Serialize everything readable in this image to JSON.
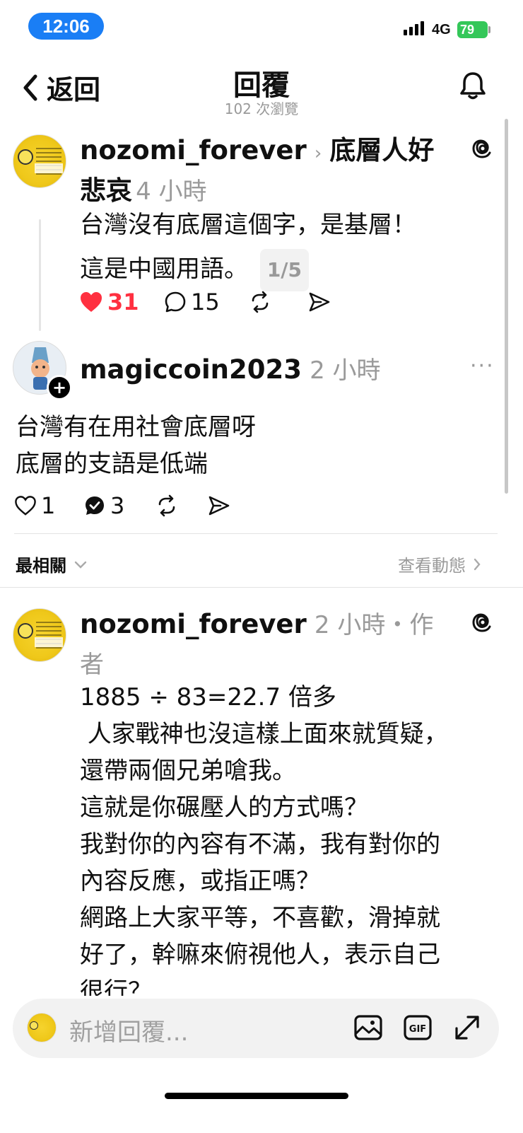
{
  "status_bar": {
    "time": "12:06",
    "network": "4G",
    "battery": "79"
  },
  "header": {
    "back_label": "返回",
    "title": "回覆",
    "views": "102 次瀏覽"
  },
  "post1": {
    "username": "nozomi_forever",
    "topic_line1": "底層人好",
    "topic_line2": "悲哀",
    "time": "4 小時",
    "text_line1": "台灣沒有底層這個字，是基層！",
    "text_line2": "這是中國用語。",
    "pager": "1/5",
    "likes": "31",
    "comments": "15"
  },
  "reply1": {
    "username": "magiccoin2023",
    "time": "2 小時",
    "text_line1": "台灣有在用社會底層呀",
    "text_line2": "底層的支語是低端",
    "likes": "1",
    "comments": "3"
  },
  "sort": {
    "label": "最相關",
    "activity": "查看動態"
  },
  "post2": {
    "username": "nozomi_forever",
    "time_line1": "2 小時・作",
    "time_line2": "者",
    "lines": [
      "1885 ÷ 83=22.7 倍多",
      " 人家戰神也沒這樣上面來就質疑，",
      "還帶兩個兄弟嗆我。",
      "這就是你碾壓人的方式嗎？",
      "我對你的內容有不滿，我有對你的",
      "內容反應，或指正嗎？",
      "網路上大家平等，不喜歡，滑掉就",
      "好了，幹嘛來俯視他人，表示自己",
      "很行？"
    ]
  },
  "composer": {
    "placeholder": "新增回覆..."
  },
  "colors": {
    "like_red": "#ff3040",
    "status_blue": "#1a7ef5",
    "battery_green": "#34c759"
  }
}
